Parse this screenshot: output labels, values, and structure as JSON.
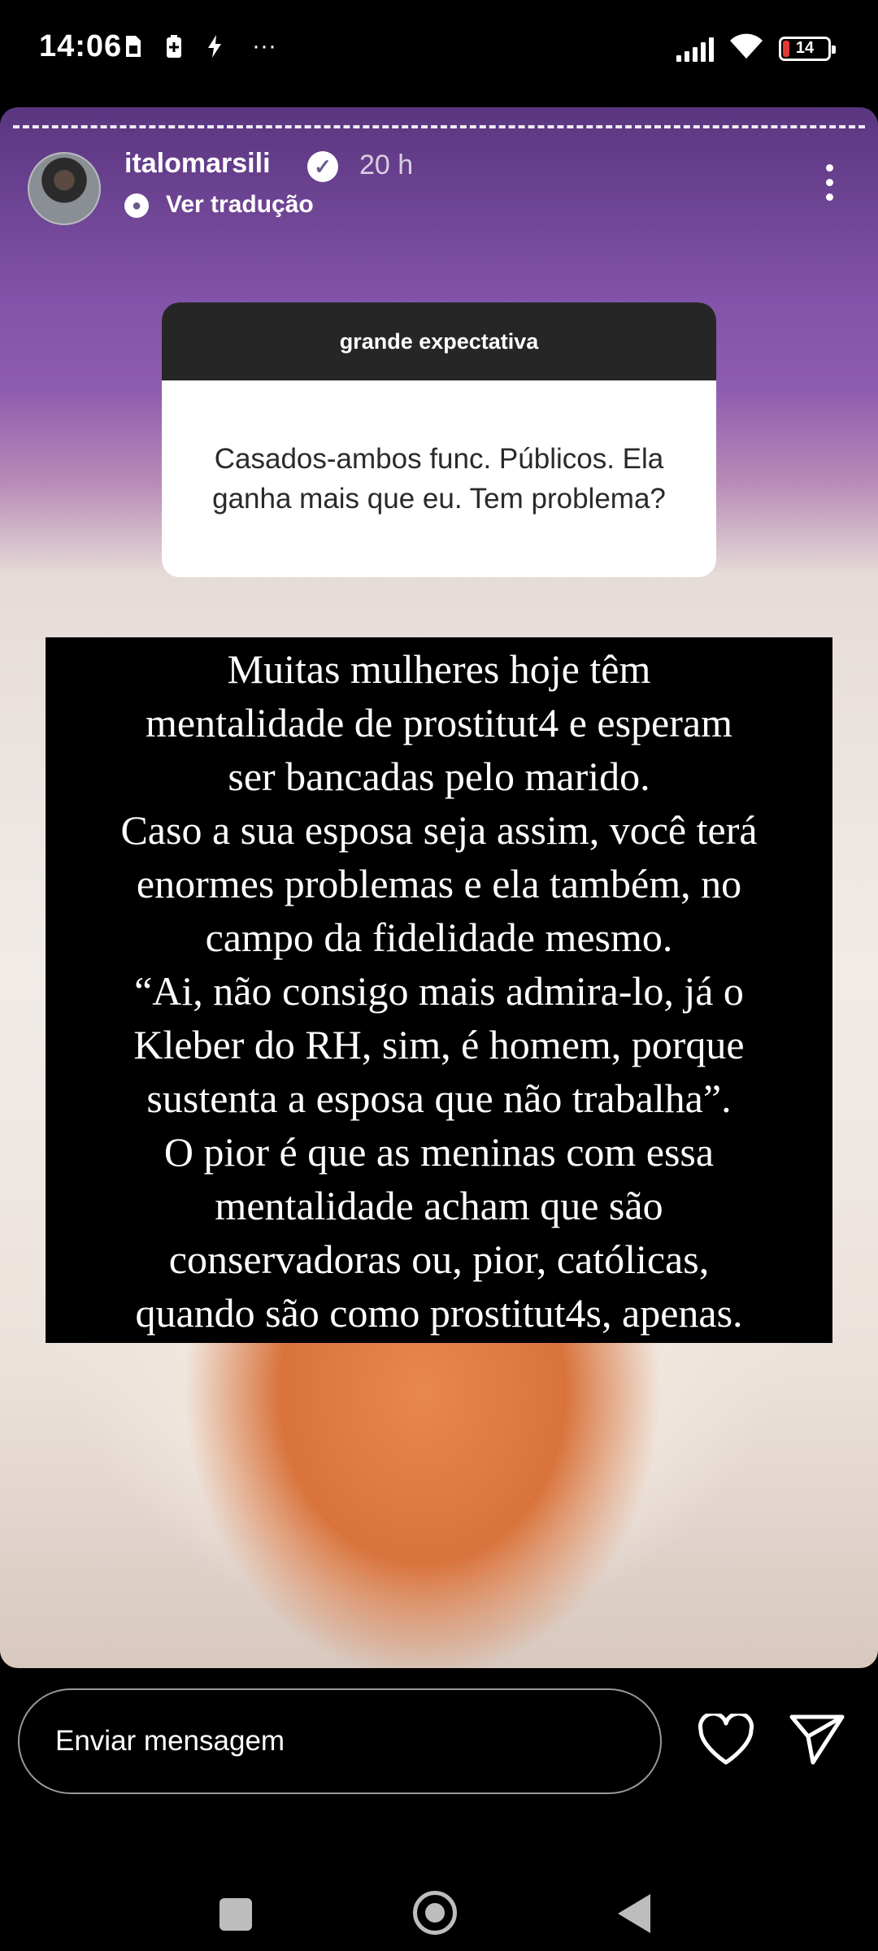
{
  "status_bar": {
    "time": "14:06",
    "battery": "14",
    "icons": [
      "sim-icon",
      "battery-saver-icon",
      "flash-icon",
      "more-dots-icon",
      "signal-icon",
      "wifi-icon",
      "battery-icon"
    ],
    "more": "···"
  },
  "story": {
    "username": "italomarsili",
    "verified": true,
    "time_ago": "20 h",
    "translate_label": "Ver tradução",
    "question": {
      "header": "grande expectativa",
      "text": "Casados-ambos func. Públicos. Ela ganha mais que eu. Tem problema?"
    },
    "answer_lines": [
      "Muitas mulheres hoje têm",
      "mentalidade de prostitut4 e esperam",
      "ser bancadas pelo marido.",
      "Caso a sua esposa seja assim, você terá",
      "enormes problemas e ela também, no",
      "campo da fidelidade mesmo.",
      "“Ai, não consigo mais admira-lo, já o",
      "Kleber do RH, sim, é homem, porque",
      "sustenta a esposa que não trabalha”.",
      "O pior é que as meninas com essa",
      "mentalidade acham que são",
      "conservadoras ou, pior, católicas,",
      "quando são como prostitut4s, apenas."
    ]
  },
  "bottom_bar": {
    "message_placeholder": "Enviar mensagem"
  },
  "colors": {
    "background": "#000000",
    "question_header_bg": "#262626",
    "answer_bg": "#000000"
  }
}
